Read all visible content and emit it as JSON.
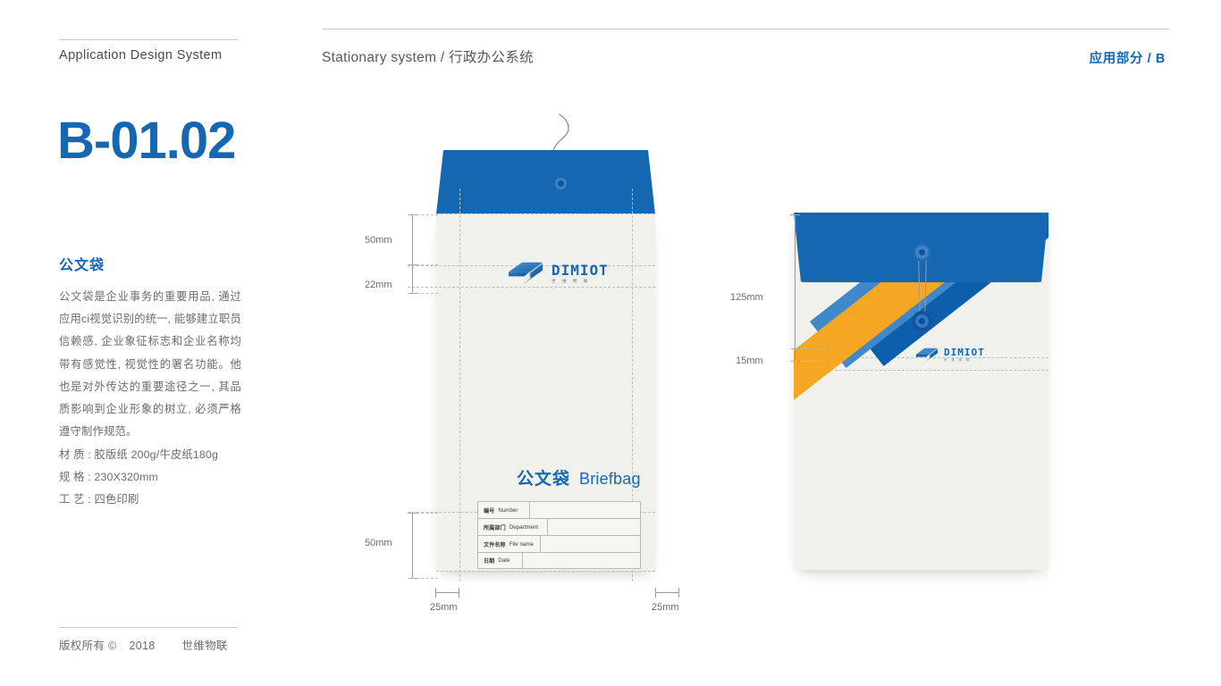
{
  "header": {
    "left_label": "Application Design System",
    "center_label": "Stationary system /  行政办公系统",
    "right_label": "应用部分  /  B"
  },
  "page_code": "B-01.02",
  "sidebar": {
    "title": "公文袋",
    "body": "公文袋是企业事务的重要用品, 通过应用ci视觉识别的统一, 能够建立职员信赖感, 企业象征标志和企业名称均带有感觉性, 视觉性的署名功能。他也是对外传达的重要途径之一, 其品质影响到企业形象的树立, 必须严格遵守制作规范。",
    "specs": {
      "material": "材 质 : 胶版纸 200g/牛皮纸180g",
      "size": "规 格 : 230X320mm",
      "process": "工 艺 : 四色印刷"
    }
  },
  "footer": {
    "copyright": "版权所有 ©",
    "year": "2018",
    "company": "世维物联"
  },
  "logo": {
    "wordmark": "DIMIOT",
    "sub": "世 维 物 联",
    "mark_name": "dimiot-diamond-arrow-mark"
  },
  "envelope_front": {
    "print_title_cn": "公文袋",
    "print_title_en": "Briefbag",
    "form_rows": [
      {
        "cn": "编号",
        "en": "Number",
        "label_width": 58
      },
      {
        "cn": "所属部门",
        "en": "Department",
        "label_width": 78
      },
      {
        "cn": "文件名称",
        "en": "File name",
        "label_width": 70
      },
      {
        "cn": "日期",
        "en": "Date",
        "label_width": 50
      }
    ],
    "dimensions": {
      "top_flap": "50mm",
      "logo_band": "22mm",
      "bottom_margin": "50mm",
      "left_side": "25mm",
      "right_side": "25mm"
    }
  },
  "envelope_back": {
    "dimensions": {
      "flap_depth": "125mm",
      "logo_offset": "15mm"
    }
  },
  "colors": {
    "brand_blue": "#1667b2",
    "light_blue": "#3f88ca",
    "dark_blue": "#0d5fae",
    "amber": "#f5a623",
    "paper": "#f1f1ec",
    "text_gray": "#6b6b6b",
    "rule_gray": "#c9c9c9"
  }
}
